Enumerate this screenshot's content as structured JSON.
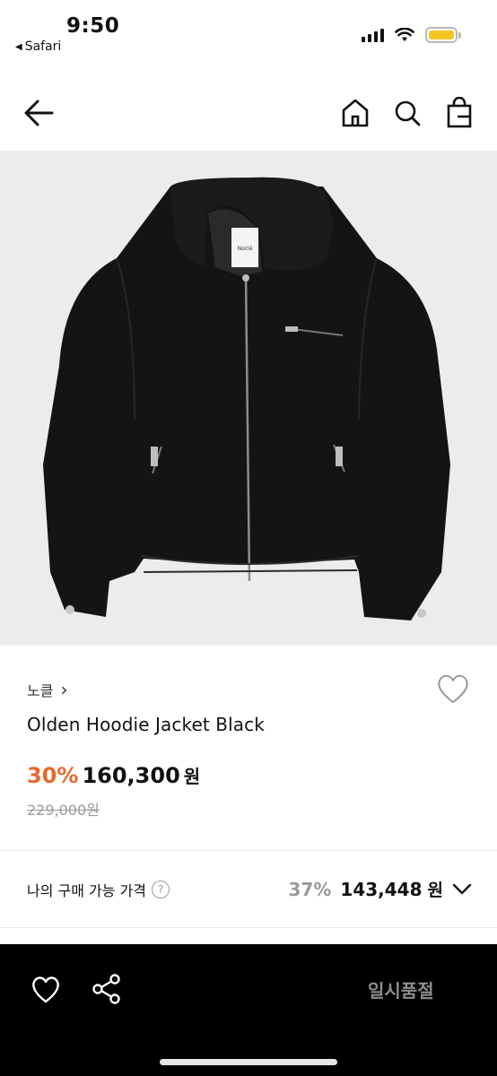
{
  "status_bar": {
    "time": "9:50",
    "back_app": "Safari",
    "battery_color": "#f3c623"
  },
  "nav": {
    "back_icon": "arrow-left-icon",
    "icons": [
      "home-icon",
      "search-icon",
      "shopping-bag-icon"
    ]
  },
  "product": {
    "brand": "노클",
    "brand_chevron": "›",
    "name": "Olden Hoodie Jacket Black",
    "discount": "30%",
    "sale_price": "160,300",
    "currency": "원",
    "original_price": "229,000원",
    "label_tag": "Noclé"
  },
  "my_price": {
    "label": "나의 구매 가능 가격",
    "help": "?",
    "discount": "37%",
    "amount": "143,448",
    "currency": "원"
  },
  "bottom_bar": {
    "status": "일시품절"
  },
  "colors": {
    "accent_discount": "#e36b2c",
    "muted": "#9a9a9a",
    "bottom_bar_bg": "#000000"
  }
}
